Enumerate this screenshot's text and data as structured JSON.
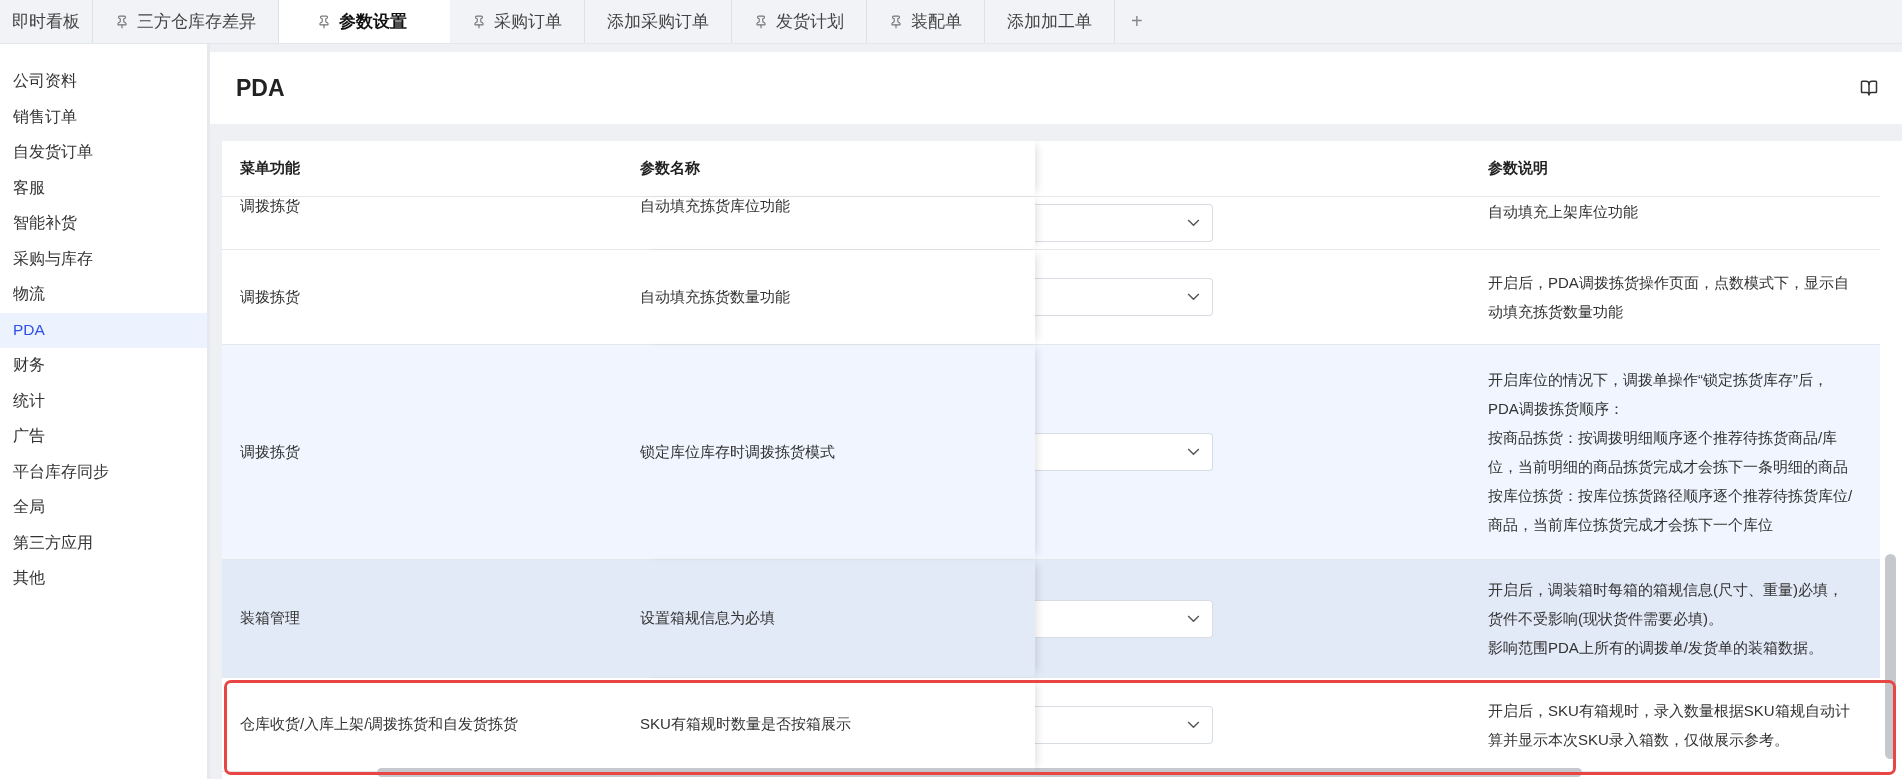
{
  "tabs": [
    {
      "label": "即时看板",
      "pinned": false,
      "selected": false
    },
    {
      "label": "三方仓库存差异",
      "pinned": true,
      "selected": false
    },
    {
      "label": "参数设置",
      "pinned": true,
      "selected": true
    },
    {
      "label": "采购订单",
      "pinned": true,
      "selected": false
    },
    {
      "label": "添加采购订单",
      "pinned": false,
      "selected": false
    },
    {
      "label": "发货计划",
      "pinned": true,
      "selected": false
    },
    {
      "label": "装配单",
      "pinned": true,
      "selected": false
    },
    {
      "label": "添加加工单",
      "pinned": false,
      "selected": false
    }
  ],
  "add_tab": "+",
  "sidebar": {
    "items": [
      {
        "label": "公司资料",
        "selected": false
      },
      {
        "label": "销售订单",
        "selected": false
      },
      {
        "label": "自发货订单",
        "selected": false
      },
      {
        "label": "客服",
        "selected": false
      },
      {
        "label": "智能补货",
        "selected": false
      },
      {
        "label": "采购与库存",
        "selected": false
      },
      {
        "label": "物流",
        "selected": false
      },
      {
        "label": "PDA",
        "selected": true
      },
      {
        "label": "财务",
        "selected": false
      },
      {
        "label": "统计",
        "selected": false
      },
      {
        "label": "广告",
        "selected": false
      },
      {
        "label": "平台库存同步",
        "selected": false
      },
      {
        "label": "全局",
        "selected": false
      },
      {
        "label": "第三方应用",
        "selected": false
      },
      {
        "label": "其他",
        "selected": false
      }
    ]
  },
  "page": {
    "title": "PDA"
  },
  "table": {
    "columns": [
      "菜单功能",
      "参数名称",
      "参数说明"
    ],
    "rows": [
      {
        "menu": "调拨拣货",
        "name": "自动填充拣货库位功能",
        "description": [
          "自动填充上架库位功能"
        ],
        "hover": false,
        "selected": false,
        "annotated": false,
        "cut_top": true
      },
      {
        "menu": "调拨拣货",
        "name": "自动填充拣货数量功能",
        "description": [
          "开启后，PDA调拨拣货操作页面，点数模式下，显示自动填充拣货数量功能"
        ],
        "hover": false,
        "selected": false,
        "annotated": false,
        "cut_top": false
      },
      {
        "menu": "调拨拣货",
        "name": "锁定库位库存时调拨拣货模式",
        "description": [
          "开启库位的情况下，调拨单操作“锁定拣货库存”后，PDA调拨拣货顺序：",
          "按商品拣货：按调拨明细顺序逐个推荐待拣货商品/库位，当前明细的商品拣货完成才会拣下一条明细的商品",
          "按库位拣货：按库位拣货路径顺序逐个推荐待拣货库位/商品，当前库位拣货完成才会拣下一个库位"
        ],
        "hover": true,
        "selected": false,
        "annotated": false,
        "cut_top": false
      },
      {
        "menu": "装箱管理",
        "name": "设置箱规信息为必填",
        "description": [
          "开启后，调装箱时每箱的箱规信息(尺寸、重量)必填，货件不受影响(现状货件需要必填)。",
          "影响范围PDA上所有的调拨单/发货单的装箱数据。"
        ],
        "hover": false,
        "selected": true,
        "annotated": false,
        "cut_top": false
      },
      {
        "menu": "仓库收货/入库上架/调拨拣货和自发货拣货",
        "name": "SKU有箱规时数量是否按箱展示",
        "description": [
          "开启后，SKU有箱规时，录入数量根据SKU箱规自动计算并显示本次SKU录入箱数，仅做展示参考。"
        ],
        "hover": false,
        "selected": false,
        "annotated": true,
        "cut_top": false
      }
    ]
  }
}
